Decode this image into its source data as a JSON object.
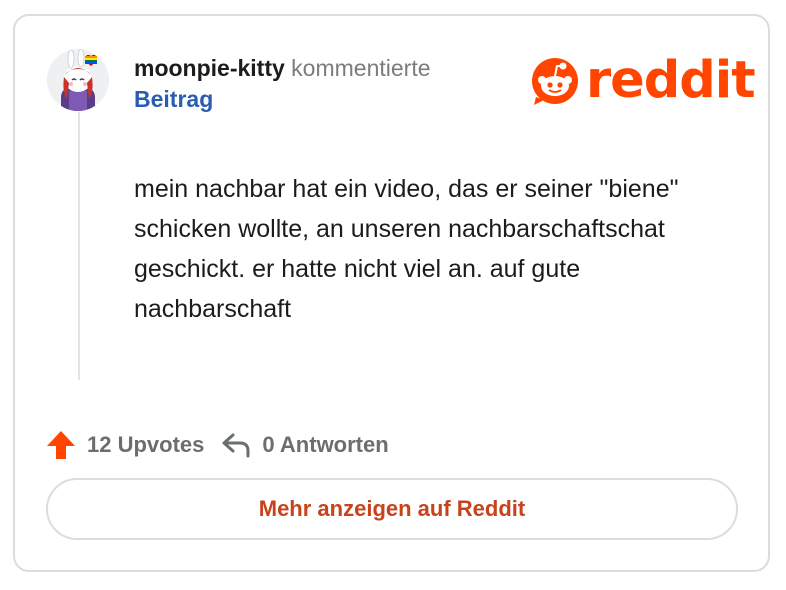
{
  "embed": {
    "username": "moonpie-kitty",
    "action_text": " kommentierte",
    "post_link": "Beitrag",
    "brand": "reddit",
    "brand_color": "#ff4500",
    "comment_text": "mein nachbar hat ein video, das er seiner \"biene\" schicken wollte, an unseren nachbarschaftschat geschickt. er hatte nicht viel an. auf gute nachbarschaft",
    "upvote_label": "12 Upvotes",
    "reply_label": "0 Antworten",
    "more_button_label": "Mehr anzeigen auf Reddit",
    "link_color": "#2a5db0",
    "button_text_color": "#c6431b"
  },
  "icons": {
    "avatar": "avatar-icon",
    "logo": "reddit-snoo-icon",
    "upvote": "upvote-arrow-icon",
    "reply": "reply-arrow-icon"
  }
}
